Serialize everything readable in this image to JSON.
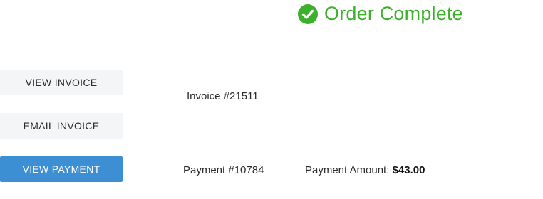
{
  "header": {
    "title": "Order Complete",
    "icon": "check-circle-icon",
    "accent_color": "#3cb02a"
  },
  "actions": {
    "view_invoice": "VIEW INVOICE",
    "email_invoice": "EMAIL INVOICE",
    "view_payment": "VIEW PAYMENT"
  },
  "details": {
    "invoice": "Invoice #21511",
    "payment": "Payment #10784",
    "payment_amount_label": "Payment Amount:",
    "payment_amount_value": "$43.00"
  },
  "colors": {
    "primary_button": "#3d8fd4",
    "secondary_button": "#f4f5f7"
  }
}
